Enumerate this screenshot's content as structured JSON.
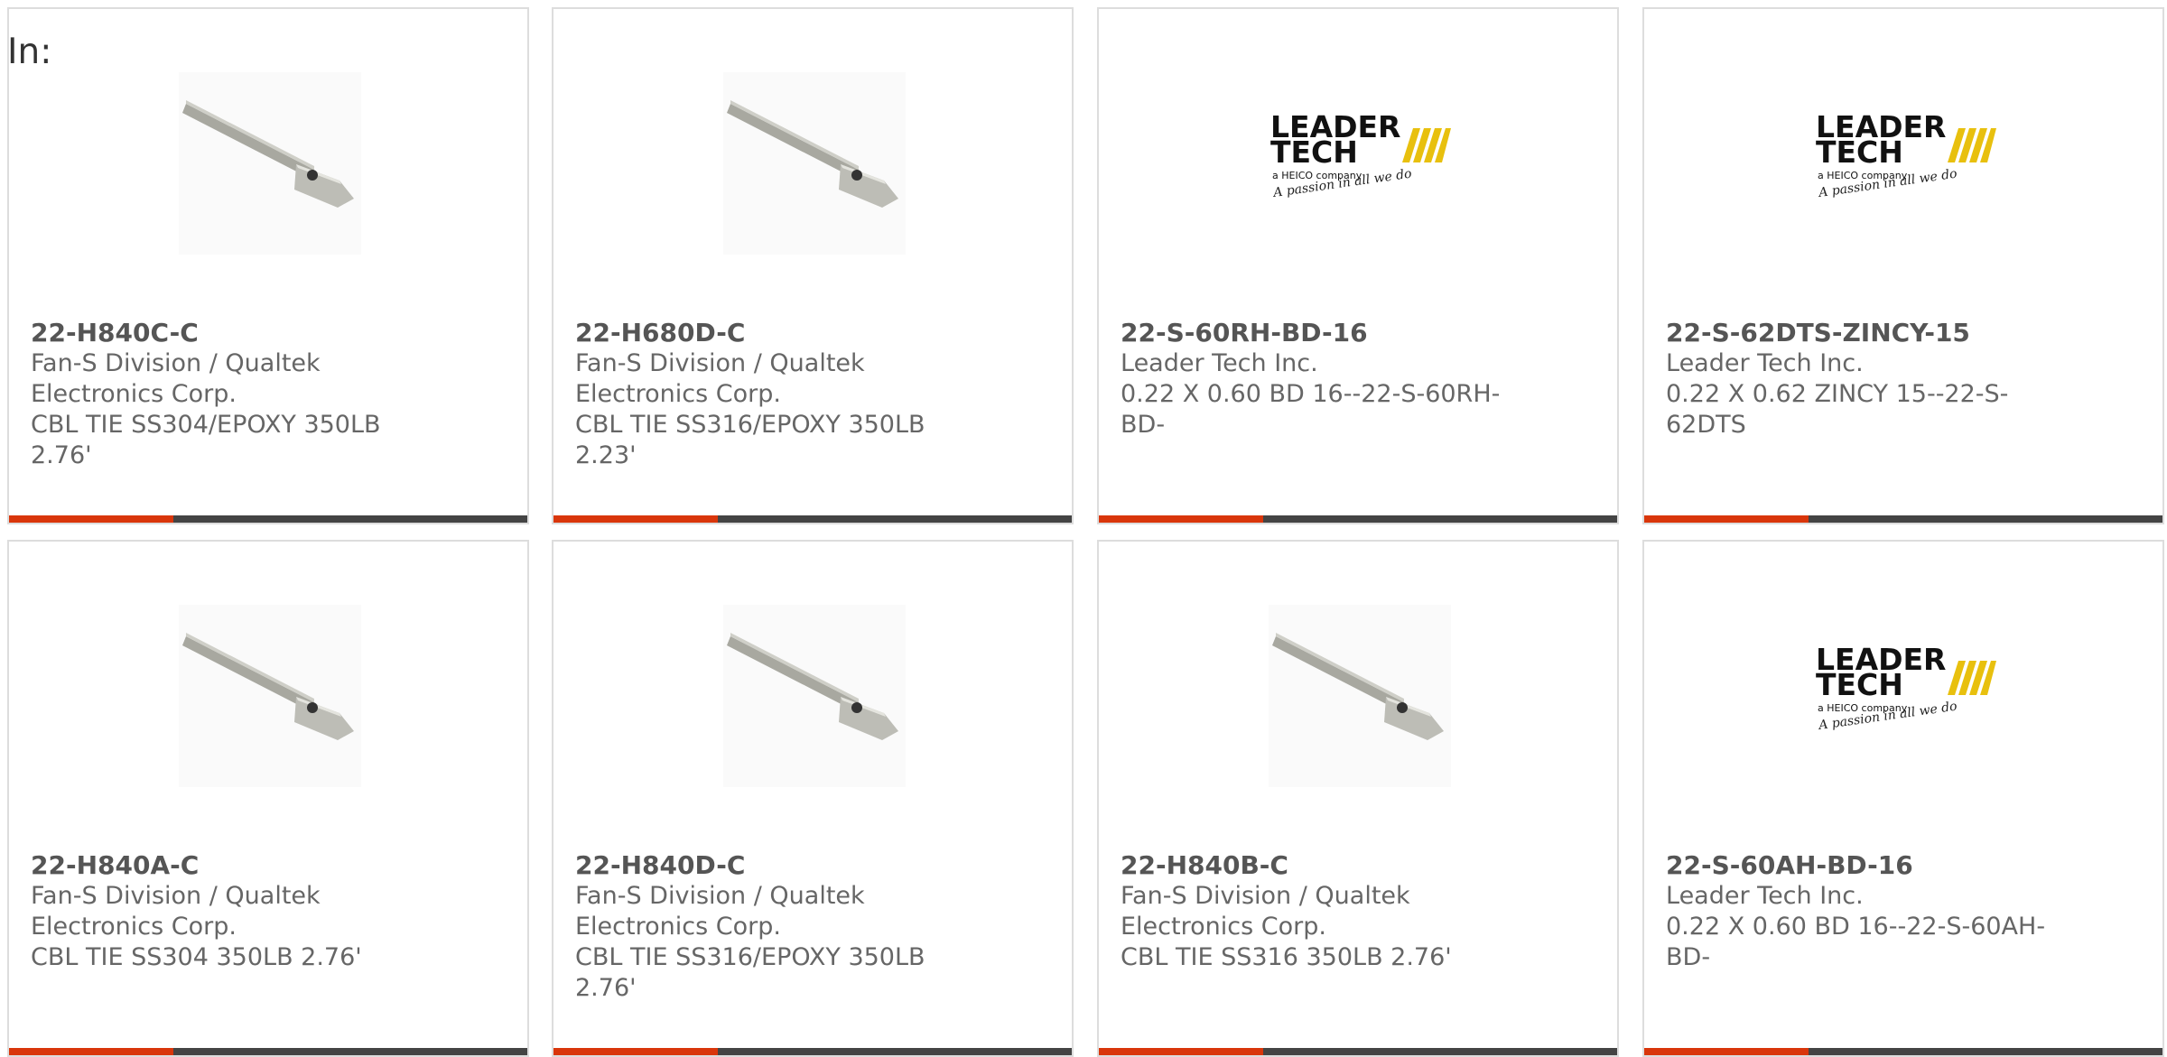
{
  "header": {
    "in_label": "In:"
  },
  "colors": {
    "accent_bar": "#d9360b",
    "bar_base": "#444444",
    "leader_yellow": "#e8c00e"
  },
  "logo": {
    "line1": "LEADER",
    "line2": "TECH",
    "line3": "a HEICO company",
    "line4": "A passion in all we do"
  },
  "products": [
    {
      "part": "22-H840C-C",
      "maker_line1": "Fan-S Division / Qualtek",
      "maker_line2": "Electronics Corp.",
      "desc_line1": "CBL TIE SS304/EPOXY 350LB",
      "desc_line2": "2.76'",
      "image": "cable-tie-image"
    },
    {
      "part": "22-H680D-C",
      "maker_line1": "Fan-S Division / Qualtek",
      "maker_line2": "Electronics Corp.",
      "desc_line1": "CBL TIE SS316/EPOXY 350LB",
      "desc_line2": "2.23'",
      "image": "cable-tie-image"
    },
    {
      "part": "22-S-60RH-BD-16",
      "maker_line1": "Leader Tech Inc.",
      "maker_line2": "",
      "desc_line1": "0.22 X 0.60 BD 16--22-S-60RH-",
      "desc_line2": "BD-",
      "image": "leader-tech-logo"
    },
    {
      "part": "22-S-62DTS-ZINCY-15",
      "maker_line1": "Leader Tech Inc.",
      "maker_line2": "",
      "desc_line1": "0.22 X 0.62 ZINCY 15--22-S-",
      "desc_line2": "62DTS",
      "image": "leader-tech-logo"
    },
    {
      "part": "22-H840A-C",
      "maker_line1": "Fan-S Division / Qualtek",
      "maker_line2": "Electronics Corp.",
      "desc_line1": "CBL TIE SS304 350LB 2.76'",
      "desc_line2": "",
      "image": "cable-tie-image"
    },
    {
      "part": "22-H840D-C",
      "maker_line1": "Fan-S Division / Qualtek",
      "maker_line2": "Electronics Corp.",
      "desc_line1": "CBL TIE SS316/EPOXY 350LB",
      "desc_line2": "2.76'",
      "image": "cable-tie-image"
    },
    {
      "part": "22-H840B-C",
      "maker_line1": "Fan-S Division / Qualtek",
      "maker_line2": "Electronics Corp.",
      "desc_line1": "CBL TIE SS316 350LB 2.76'",
      "desc_line2": "",
      "image": "cable-tie-image"
    },
    {
      "part": "22-S-60AH-BD-16",
      "maker_line1": "Leader Tech Inc.",
      "maker_line2": "",
      "desc_line1": "0.22 X 0.60 BD 16--22-S-60AH-",
      "desc_line2": "BD-",
      "image": "leader-tech-logo"
    }
  ]
}
